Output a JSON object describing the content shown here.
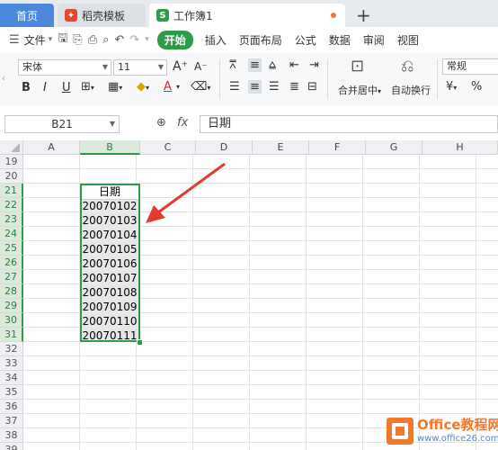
{
  "tabs": {
    "home": "首页",
    "template": "稻壳模板",
    "workbook": "工作簿1",
    "add": "+"
  },
  "menu": {
    "file": "文件",
    "start": "开始",
    "items": [
      "插入",
      "页面布局",
      "公式",
      "数据",
      "审阅",
      "视图"
    ]
  },
  "ribbon": {
    "font_name": "宋体",
    "font_size": "11",
    "merge_label": "合并居中",
    "wrap_label": "自动换行",
    "number_format": "常规",
    "font_increase": "A⁺",
    "font_decrease": "A⁻",
    "bold": "B",
    "italic": "I",
    "underline": "U",
    "font_color": "A",
    "percent": "%"
  },
  "formula_bar": {
    "cell_ref": "B21",
    "fx": "fx",
    "content": "日期"
  },
  "sheet": {
    "columns": [
      "A",
      "B",
      "C",
      "D",
      "E",
      "F",
      "G",
      "H"
    ],
    "rows": [
      "19",
      "20",
      "21",
      "22",
      "23",
      "24",
      "25",
      "26",
      "27",
      "28",
      "29",
      "30",
      "31",
      "32",
      "33",
      "34",
      "35",
      "36",
      "37",
      "38",
      "39"
    ],
    "header_cell": "日期",
    "dates": [
      "20070102",
      "20070103",
      "20070104",
      "20070105",
      "20070106",
      "20070107",
      "20070108",
      "20070109",
      "20070110",
      "20070111"
    ]
  },
  "watermark": {
    "title": "Office教程网",
    "url": "www.office26.com"
  },
  "colors": {
    "accent_green": "#2e9b4a",
    "home_tab_blue": "#4a89dc",
    "arrow_red": "#e23b2e",
    "logo_orange": "#f07a2e"
  }
}
